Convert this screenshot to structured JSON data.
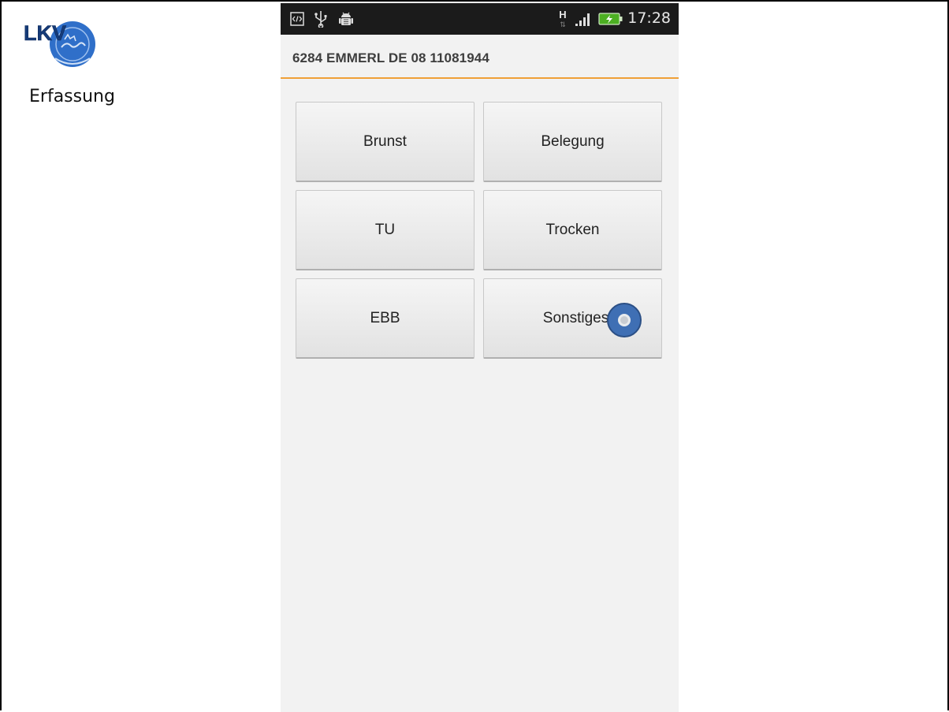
{
  "slide": {
    "caption": "Erfassung",
    "logo": {
      "text": "LKV",
      "ring_text": "Baden - Württemberg",
      "accent_color": "#2f6fc9",
      "icon": "lkv-logo"
    }
  },
  "status_bar": {
    "time": "17:28",
    "network": "H",
    "icons": [
      "code-icon",
      "usb-icon",
      "android-debug-icon",
      "signal-icon",
      "battery-charging-icon"
    ]
  },
  "app_bar": {
    "title": "6284 EMMERL DE 08 11081944",
    "divider_color": "#f0a037"
  },
  "buttons": [
    {
      "label": "Brunst"
    },
    {
      "label": "Belegung"
    },
    {
      "label": "TU"
    },
    {
      "label": "Trocken"
    },
    {
      "label": "EBB"
    },
    {
      "label": "Sonstiges"
    }
  ],
  "touch_indicator": {
    "icon": "touch-indicator",
    "color": "#3f6fb4"
  }
}
